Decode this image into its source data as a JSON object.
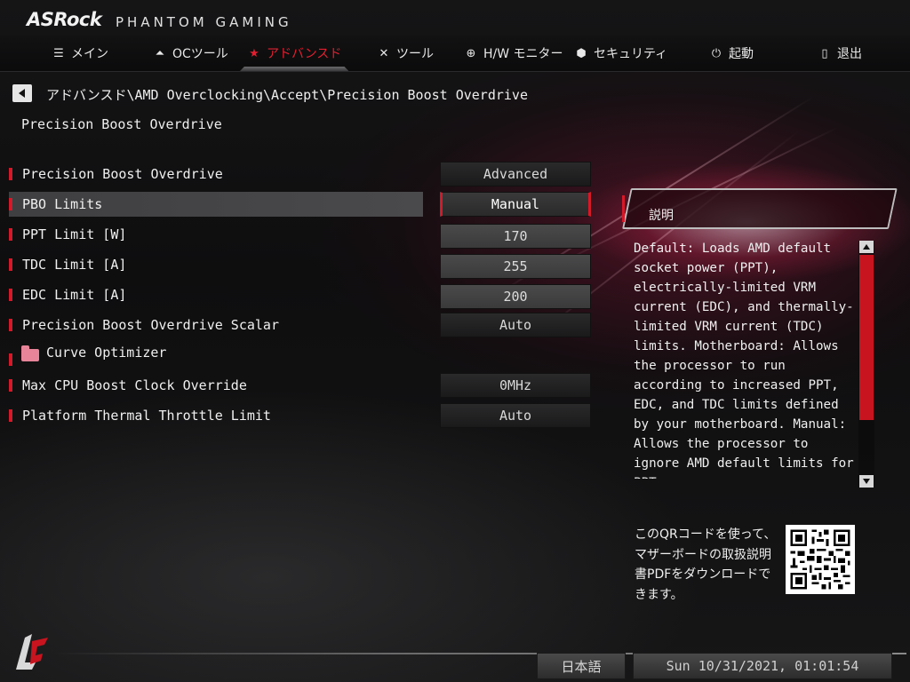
{
  "header": {
    "brand": "ASRock",
    "subtitle": "PHANTOM GAMING"
  },
  "tabs": [
    {
      "label": "メイン",
      "icon": "list-icon"
    },
    {
      "label": "OCツール",
      "icon": "rocket-icon"
    },
    {
      "label": "アドバンスド",
      "icon": "star-icon",
      "active": true
    },
    {
      "label": "ツール",
      "icon": "tools-icon"
    },
    {
      "label": "H/W モニター",
      "icon": "crosshair-icon"
    },
    {
      "label": "セキュリティ",
      "icon": "shield-icon"
    },
    {
      "label": "起動",
      "icon": "power-icon"
    },
    {
      "label": "退出",
      "icon": "exit-door-icon"
    }
  ],
  "breadcrumb": "アドバンスド\\AMD Overclocking\\Accept\\Precision Boost Overdrive",
  "page_title": "Precision Boost Overdrive",
  "settings": [
    {
      "label": "Precision Boost Overdrive",
      "value": "Advanced"
    },
    {
      "label": "PBO Limits",
      "value": "Manual",
      "selected": true
    },
    {
      "label": "PPT Limit [W]",
      "value": "170",
      "input": true
    },
    {
      "label": "TDC Limit [A]",
      "value": "255",
      "input": true
    },
    {
      "label": "EDC Limit [A]",
      "value": "200",
      "input": true
    },
    {
      "label": "Precision Boost Overdrive Scalar",
      "value": "Auto"
    },
    {
      "label": "Curve Optimizer",
      "folder": true
    },
    {
      "label": "Max CPU Boost Clock Override",
      "value": "0MHz"
    },
    {
      "label": "Platform Thermal Throttle Limit",
      "value": "Auto"
    }
  ],
  "description": {
    "title": "説明",
    "text": "Default: Loads AMD default socket power (PPT), electrically-limited VRM current (EDC), and thermally-limited VRM current (TDC) limits. Motherboard: Allows the processor to run according to increased PPT, EDC, and TDC limits defined by your motherboard. Manual: Allows the processor to ignore AMD default limits for PPT,"
  },
  "qr": {
    "text": "このQRコードを使って、マザーボードの取扱説明書PDFをダウンロードできます。"
  },
  "footer": {
    "language": "日本語",
    "datetime": "Sun 10/31/2021, 01:01:54"
  },
  "colors": {
    "accent": "#d11a2a",
    "background": "#0c0c0d",
    "selected_row": "#464648"
  }
}
